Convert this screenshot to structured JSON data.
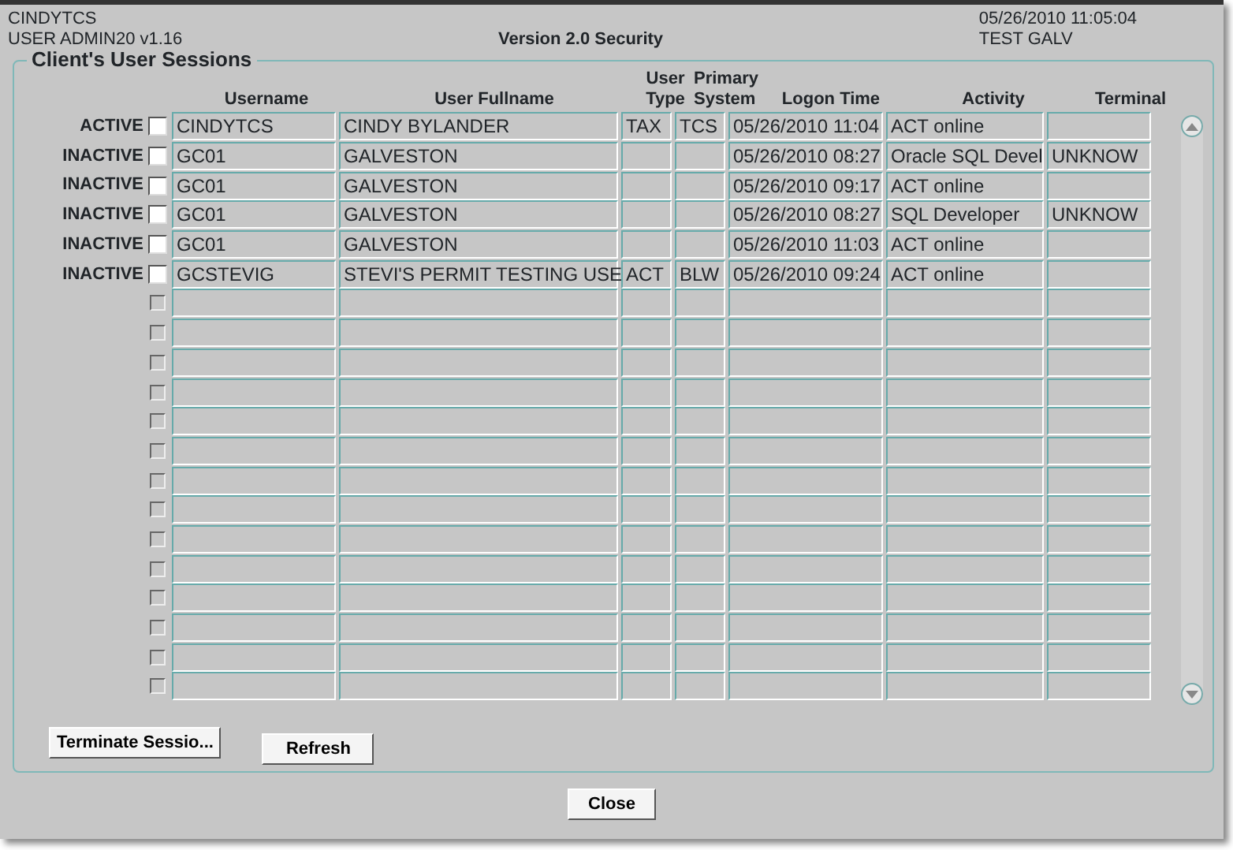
{
  "header": {
    "user": "CINDYTCS",
    "role": "USER  ADMIN20 v1.16",
    "title": "Version 2.0 Security",
    "datetime": "05/26/2010 11:05:04",
    "environment": "TEST GALV"
  },
  "panel": {
    "title": "Client's User Sessions",
    "columns": [
      {
        "label": "Username"
      },
      {
        "label": "User Fullname"
      },
      {
        "label": "User Type"
      },
      {
        "label": "Primary System"
      },
      {
        "label": "Logon Time"
      },
      {
        "label": "Activity"
      },
      {
        "label": "Terminal"
      }
    ],
    "rows": [
      {
        "status": "ACTIVE",
        "checked": false,
        "disabled": false,
        "cells": [
          "CINDYTCS",
          "CINDY BYLANDER",
          "TAX",
          "TCS",
          "05/26/2010 11:04",
          "ACT online",
          ""
        ]
      },
      {
        "status": "INACTIVE",
        "checked": false,
        "disabled": false,
        "cells": [
          "GC01",
          "GALVESTON",
          "",
          "",
          "05/26/2010 08:27",
          "Oracle SQL Devel",
          "UNKNOW"
        ]
      },
      {
        "status": "INACTIVE",
        "checked": false,
        "disabled": false,
        "cells": [
          "GC01",
          "GALVESTON",
          "",
          "",
          "05/26/2010 09:17",
          "ACT online",
          ""
        ]
      },
      {
        "status": "INACTIVE",
        "checked": false,
        "disabled": false,
        "cells": [
          "GC01",
          "GALVESTON",
          "",
          "",
          "05/26/2010 08:27",
          "SQL Developer",
          "UNKNOW"
        ]
      },
      {
        "status": "INACTIVE",
        "checked": false,
        "disabled": false,
        "cells": [
          "GC01",
          "GALVESTON",
          "",
          "",
          "05/26/2010 11:03",
          "ACT online",
          ""
        ]
      },
      {
        "status": "INACTIVE",
        "checked": false,
        "disabled": false,
        "cells": [
          "GCSTEVIG",
          "STEVI'S PERMIT TESTING USE",
          "ACT",
          "BLW",
          "05/26/2010 09:24",
          "ACT online",
          ""
        ]
      },
      {
        "checked": false,
        "disabled": true
      },
      {
        "checked": false,
        "disabled": true
      },
      {
        "checked": false,
        "disabled": true
      },
      {
        "checked": false,
        "disabled": true
      },
      {
        "checked": false,
        "disabled": true
      },
      {
        "checked": false,
        "disabled": true
      },
      {
        "checked": false,
        "disabled": true
      },
      {
        "checked": false,
        "disabled": true
      },
      {
        "checked": false,
        "disabled": true
      },
      {
        "checked": false,
        "disabled": true
      },
      {
        "checked": false,
        "disabled": true
      },
      {
        "checked": false,
        "disabled": true
      },
      {
        "checked": false,
        "disabled": true
      },
      {
        "checked": false,
        "disabled": true
      }
    ],
    "buttons": [
      {
        "label": "Terminate Sessio..."
      },
      {
        "label": "Refresh"
      }
    ]
  },
  "footer_buttons": [
    {
      "label": "Close"
    }
  ]
}
